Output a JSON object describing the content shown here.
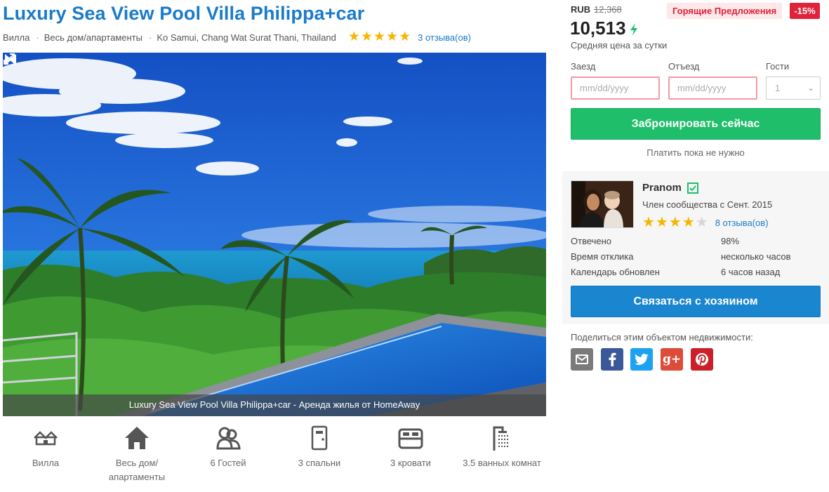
{
  "listing": {
    "title": "Luxury Sea View Pool Villa Philippa+car",
    "type": "Вилла",
    "category": "Весь дом/апартаменты",
    "location": "Ko Samui, Chang Wat Surat Thani, Thailand",
    "rating_stars": 5,
    "reviews_label": "3 отзыва(ов)"
  },
  "gallery": {
    "caption": "Luxury Sea View Pool Villa Philippa+car - Аренда жилья от HomeAway",
    "expand_icon": "expand-icon",
    "prev_icon": "arrow-left-icon",
    "next_icon": "arrow-right-icon"
  },
  "features": [
    {
      "icon": "villa-icon",
      "label": "Вилла"
    },
    {
      "icon": "house-icon",
      "label": "Весь дом/ апартаменты"
    },
    {
      "icon": "guests-icon",
      "label": "6 Гостей"
    },
    {
      "icon": "door-icon",
      "label": "3 спальни"
    },
    {
      "icon": "bed-icon",
      "label": "3 кровати"
    },
    {
      "icon": "shower-icon",
      "label": "3.5 ванных комнат"
    }
  ],
  "pricing": {
    "currency": "RUB",
    "old_price": "12,368",
    "price": "10,513",
    "price_note": "Средняя цена за сутки",
    "hot_badge": "Горящие Предложения",
    "discount_badge": "-15%"
  },
  "booking": {
    "checkin_label": "Заезд",
    "checkin_placeholder": "mm/dd/yyyy",
    "checkout_label": "Отъезд",
    "checkout_placeholder": "mm/dd/yyyy",
    "guests_label": "Гости",
    "guests_value": "1",
    "book_button": "Забронировать сейчас",
    "pay_note": "Платить пока не нужно"
  },
  "host": {
    "name": "Pranom",
    "member_since": "Член сообщества с Сент. 2015",
    "rating_stars": 4,
    "reviews_label": "8 отзыва(ов)",
    "stats": [
      {
        "label": "Отвечено",
        "value": "98%"
      },
      {
        "label": "Время отклика",
        "value": "несколько часов"
      },
      {
        "label": "Календарь обновлен",
        "value": "6 часов назад"
      }
    ],
    "contact_button": "Связаться с хозяином"
  },
  "share": {
    "label": "Поделиться этим объектом недвижимости:",
    "buttons": [
      {
        "icon": "email-icon",
        "color": "#7a7a7a"
      },
      {
        "icon": "facebook-icon",
        "color": "#3b5998"
      },
      {
        "icon": "twitter-icon",
        "color": "#1da1f2"
      },
      {
        "icon": "google-plus-icon",
        "color": "#dd4b39"
      },
      {
        "icon": "pinterest-icon",
        "color": "#cb2027"
      }
    ]
  },
  "colors": {
    "accent": "#1a7bc9",
    "book": "#1fbe6a",
    "contact": "#1a86cf",
    "hot": "#e0223a",
    "star": "#f7b500"
  }
}
